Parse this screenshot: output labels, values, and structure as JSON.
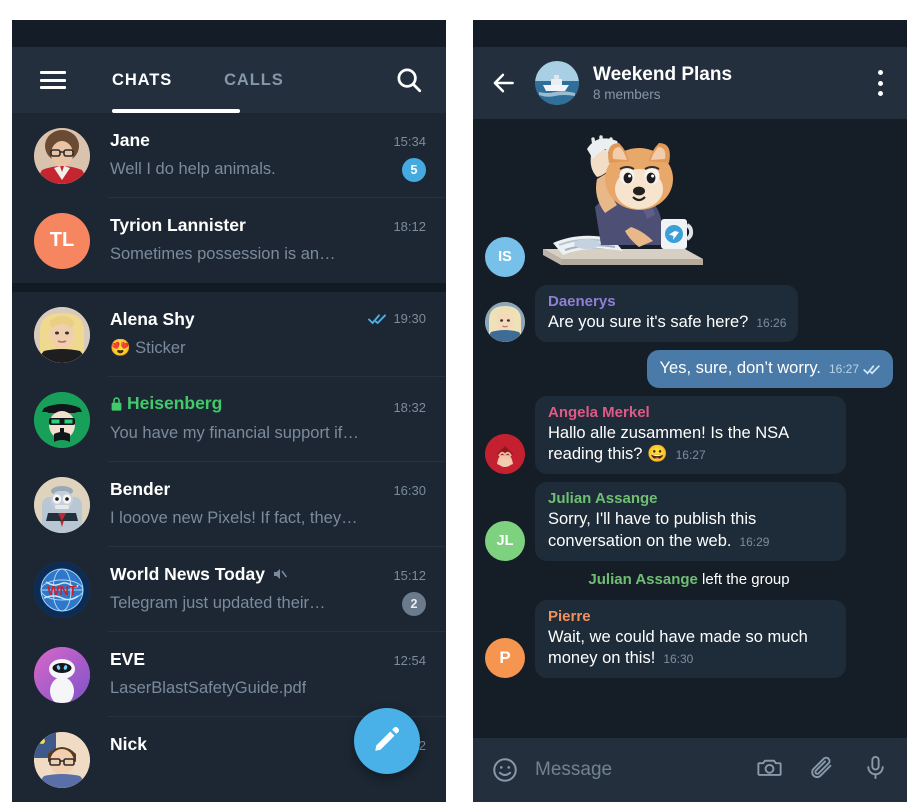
{
  "app": {
    "name": "Telegram"
  },
  "left_panel": {
    "menu_icon": "hamburger-icon",
    "tabs": [
      {
        "label": "CHATS",
        "active": true
      },
      {
        "label": "CALLS",
        "active": false
      }
    ],
    "search_icon": "search-icon",
    "compose_fab": {
      "icon": "pencil-icon",
      "color": "#49b0e8"
    },
    "chats": [
      {
        "name": "Jane",
        "preview": "Well I do help animals.",
        "time": "15:34",
        "badge": "5",
        "badge_style": "blue",
        "avatar_type": "photo",
        "avatar_initials": "",
        "avatar_color": "#c7926f"
      },
      {
        "name": "Tyrion Lannister",
        "preview": "Sometimes possession is an…",
        "time": "18:12",
        "badge": "",
        "badge_style": "",
        "avatar_type": "initials",
        "avatar_initials": "TL",
        "avatar_color": "#f5865f"
      },
      {
        "name": "Alena Shy",
        "preview": "😍 Sticker",
        "time": "19:30",
        "badge": "",
        "badge_style": "",
        "read_ticks": true,
        "avatar_type": "photo",
        "avatar_initials": "",
        "avatar_color": "#d8c0a0"
      },
      {
        "name": "Heisenberg",
        "preview": "You have my financial support if…",
        "time": "18:32",
        "badge": "",
        "badge_style": "",
        "secret": true,
        "lock_icon": "lock-icon",
        "avatar_type": "photo",
        "avatar_initials": "",
        "avatar_color": "#1a9e52"
      },
      {
        "name": "Bender",
        "preview": "I looove new Pixels! If fact, they…",
        "time": "16:30",
        "badge": "",
        "badge_style": "",
        "avatar_type": "photo",
        "avatar_initials": "",
        "avatar_color": "#aab8c4"
      },
      {
        "name": "World News Today",
        "preview": "Telegram just updated their…",
        "time": "15:12",
        "badge": "2",
        "badge_style": "gray",
        "muted": true,
        "mute_icon": "muted-speaker-icon",
        "avatar_type": "photo",
        "avatar_initials": "",
        "avatar_color": "#2a5d9e"
      },
      {
        "name": "EVE",
        "preview": "LaserBlastSafetyGuide.pdf",
        "time": "12:54",
        "badge": "",
        "badge_style": "",
        "avatar_type": "photo",
        "avatar_initials": "",
        "avatar_color": "#c05bbd"
      },
      {
        "name": "Nick",
        "preview": "",
        "time": "12:22",
        "badge": "",
        "badge_style": "",
        "avatar_type": "photo",
        "avatar_initials": "",
        "avatar_color": "#e8c8a8"
      }
    ]
  },
  "right_panel": {
    "back_icon": "back-arrow-icon",
    "menu_icon": "kebab-menu-icon",
    "title": "Weekend Plans",
    "subtitle": "8 members",
    "avatar_name": "group-avatar-boat",
    "messages": [
      {
        "kind": "sticker",
        "avatar_initials": "IS",
        "avatar_color": "#77c0ea",
        "sticker_name": "shiba-dog-reading-newspaper-sticker"
      },
      {
        "kind": "in",
        "sender": "Daenerys",
        "sender_color": "#8f7fd6",
        "text": "Are you sure it's safe here?",
        "time": "16:26",
        "avatar_type": "photo",
        "avatar_color": "#d9c28f"
      },
      {
        "kind": "out",
        "sender": "",
        "text": "Yes, sure, don’t worry.",
        "time": "16:27",
        "ticks": true
      },
      {
        "kind": "in",
        "sender": "Angela Merkel",
        "sender_color": "#e05a86",
        "text": "Hallo alle zusammen! Is the NSA reading this? 😀",
        "time": "16:27",
        "avatar_type": "photo",
        "avatar_color": "#c42b3a"
      },
      {
        "kind": "in",
        "sender": "Julian Assange",
        "sender_color": "#6fbf73",
        "text": "Sorry, I'll have to publish this conversation on the web.",
        "time": "16:29",
        "avatar_type": "initials",
        "avatar_initials": "JL",
        "avatar_color": "#7ed17e"
      },
      {
        "kind": "service",
        "actor": "Julian Assange",
        "text": " left the group"
      },
      {
        "kind": "in",
        "sender": "Pierre",
        "sender_color": "#f0925e",
        "text": "Wait, we could have made so much money on this!",
        "time": "16:30",
        "avatar_type": "initials",
        "avatar_initials": "P",
        "avatar_color": "#f5954f"
      }
    ],
    "composer": {
      "emoji_icon": "smiley-face-icon",
      "placeholder": "Message",
      "camera_icon": "camera-icon",
      "attach_icon": "paperclip-icon",
      "mic_icon": "microphone-icon"
    }
  },
  "colors": {
    "accent": "#49b0e8",
    "panel_bg": "#1c2733",
    "conv_bg": "#151e27",
    "header_bg": "#232f3d",
    "bubble_in": "#1e2b38",
    "bubble_out": "#4a7aa8",
    "secret_green": "#41c96a"
  }
}
